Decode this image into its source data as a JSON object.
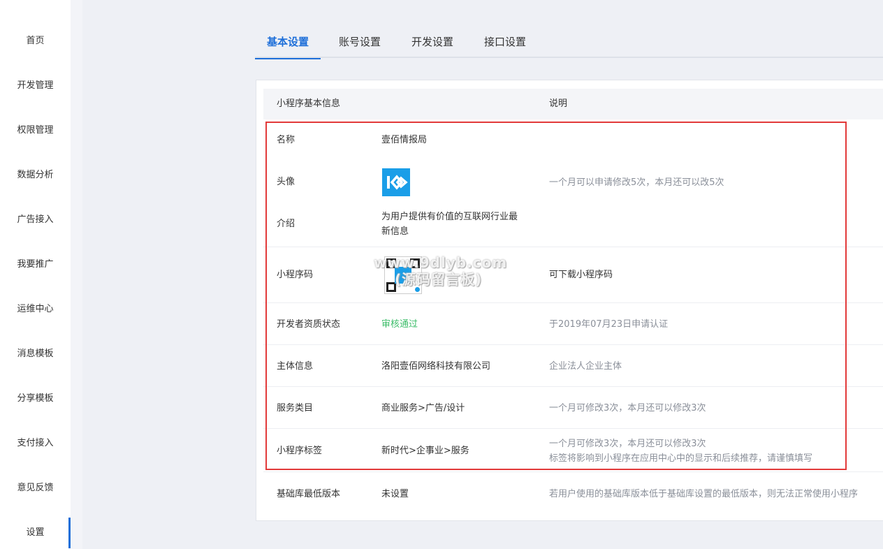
{
  "sidebar": {
    "items": [
      {
        "label": "首页"
      },
      {
        "label": "开发管理"
      },
      {
        "label": "权限管理"
      },
      {
        "label": "数据分析"
      },
      {
        "label": "广告接入"
      },
      {
        "label": "我要推广"
      },
      {
        "label": "运维中心"
      },
      {
        "label": "消息模板"
      },
      {
        "label": "分享模板"
      },
      {
        "label": "支付接入"
      },
      {
        "label": "意见反馈"
      },
      {
        "label": "设置"
      }
    ],
    "active_item": "设置"
  },
  "tabs": [
    {
      "label": "基本设置",
      "active": true
    },
    {
      "label": "账号设置",
      "active": false
    },
    {
      "label": "开发设置",
      "active": false
    },
    {
      "label": "接口设置",
      "active": false
    }
  ],
  "table": {
    "header": {
      "col1": "小程序基本信息",
      "col2": "说明"
    },
    "rows": {
      "name": {
        "label": "名称",
        "value": "壹佰情报局"
      },
      "avatar": {
        "label": "头像",
        "icon": "brand-logo-icon",
        "desc": "一个月可以申请修改5次，本月还可以改5次"
      },
      "intro": {
        "label": "介绍",
        "value_line1": "为用户提供有价值的互联网行业最",
        "value_line2": "新信息"
      },
      "qrcode": {
        "label": "小程序码",
        "icon": "qrcode-icon",
        "desc": "可下载小程序码"
      },
      "dev_status": {
        "label": "开发者资质状态",
        "value": "审核通过",
        "desc": "于2019年07月23日申请认证"
      },
      "subject": {
        "label": "主体信息",
        "value": "洛阳壹佰网络科技有限公司",
        "desc": "企业法人企业主体"
      },
      "category": {
        "label": "服务类目",
        "value": "商业服务>广告/设计",
        "desc": "一个月可修改3次，本月还可以修改3次"
      },
      "tags": {
        "label": "小程序标签",
        "value": "新时代>企事业>服务",
        "desc_line1": "一个月可修改3次，本月还可以修改3次",
        "desc_line2": "标签将影响到小程序在应用中心中的显示和后续推荐，请谨慎填写"
      },
      "base_lib": {
        "label": "基础库最低版本",
        "value": "未设置",
        "desc": "若用户使用的基础库版本低于基础库设置的最低版本，则无法正常使用小程序"
      }
    }
  },
  "watermark": {
    "line1": "www.9dlyb.com",
    "line2": "(源码留言板)"
  },
  "colors": {
    "accent": "#1e6fd9",
    "success": "#3dbd6a",
    "highlight": "#e23a3a",
    "brand": "#1a9ee8"
  }
}
